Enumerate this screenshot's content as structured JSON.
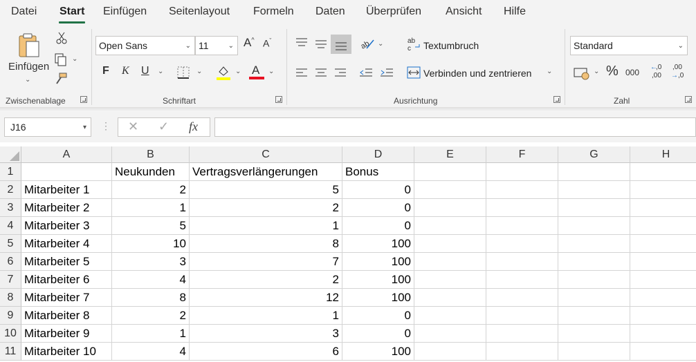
{
  "tabs": [
    "Datei",
    "Start",
    "Einfügen",
    "Seitenlayout",
    "Formeln",
    "Daten",
    "Überprüfen",
    "Ansicht",
    "Hilfe"
  ],
  "active_tab": "Start",
  "ribbon": {
    "clipboard": {
      "paste_label": "Einfügen",
      "group_label": "Zwischenablage"
    },
    "font": {
      "font_name": "Open Sans",
      "font_size": "11",
      "group_label": "Schriftart",
      "highlight_color": "#ffff00",
      "font_color": "#e81123"
    },
    "alignment": {
      "wrap_label": "Textumbruch",
      "merge_label": "Verbinden und zentrieren",
      "group_label": "Ausrichtung"
    },
    "number": {
      "format": "Standard",
      "percent": "%",
      "thousands": "000",
      "increase_decimal": ",00",
      "decrease_decimal": ",0",
      "group_label": "Zahl"
    }
  },
  "formula_bar": {
    "name_box": "J16",
    "formula": ""
  },
  "sheet": {
    "columns": [
      "A",
      "B",
      "C",
      "D",
      "E",
      "F",
      "G",
      "H"
    ],
    "rows": [
      "1",
      "2",
      "3",
      "4",
      "5",
      "6",
      "7",
      "8",
      "9",
      "10",
      "11"
    ],
    "cells": [
      [
        "",
        "Neukunden",
        "Vertragsverlängerungen",
        "Bonus",
        "",
        "",
        "",
        ""
      ],
      [
        "Mitarbeiter 1",
        "2",
        "5",
        "0",
        "",
        "",
        "",
        ""
      ],
      [
        "Mitarbeiter 2",
        "1",
        "2",
        "0",
        "",
        "",
        "",
        ""
      ],
      [
        "Mitarbeiter 3",
        "5",
        "1",
        "0",
        "",
        "",
        "",
        ""
      ],
      [
        "Mitarbeiter 4",
        "10",
        "8",
        "100",
        "",
        "",
        "",
        ""
      ],
      [
        "Mitarbeiter 5",
        "3",
        "7",
        "100",
        "",
        "",
        "",
        ""
      ],
      [
        "Mitarbeiter 6",
        "4",
        "2",
        "100",
        "",
        "",
        "",
        ""
      ],
      [
        "Mitarbeiter 7",
        "8",
        "12",
        "100",
        "",
        "",
        "",
        ""
      ],
      [
        "Mitarbeiter 8",
        "2",
        "1",
        "0",
        "",
        "",
        "",
        ""
      ],
      [
        "Mitarbeiter 9",
        "1",
        "3",
        "0",
        "",
        "",
        "",
        ""
      ],
      [
        "Mitarbeiter 10",
        "4",
        "6",
        "100",
        "",
        "",
        "",
        ""
      ]
    ]
  }
}
